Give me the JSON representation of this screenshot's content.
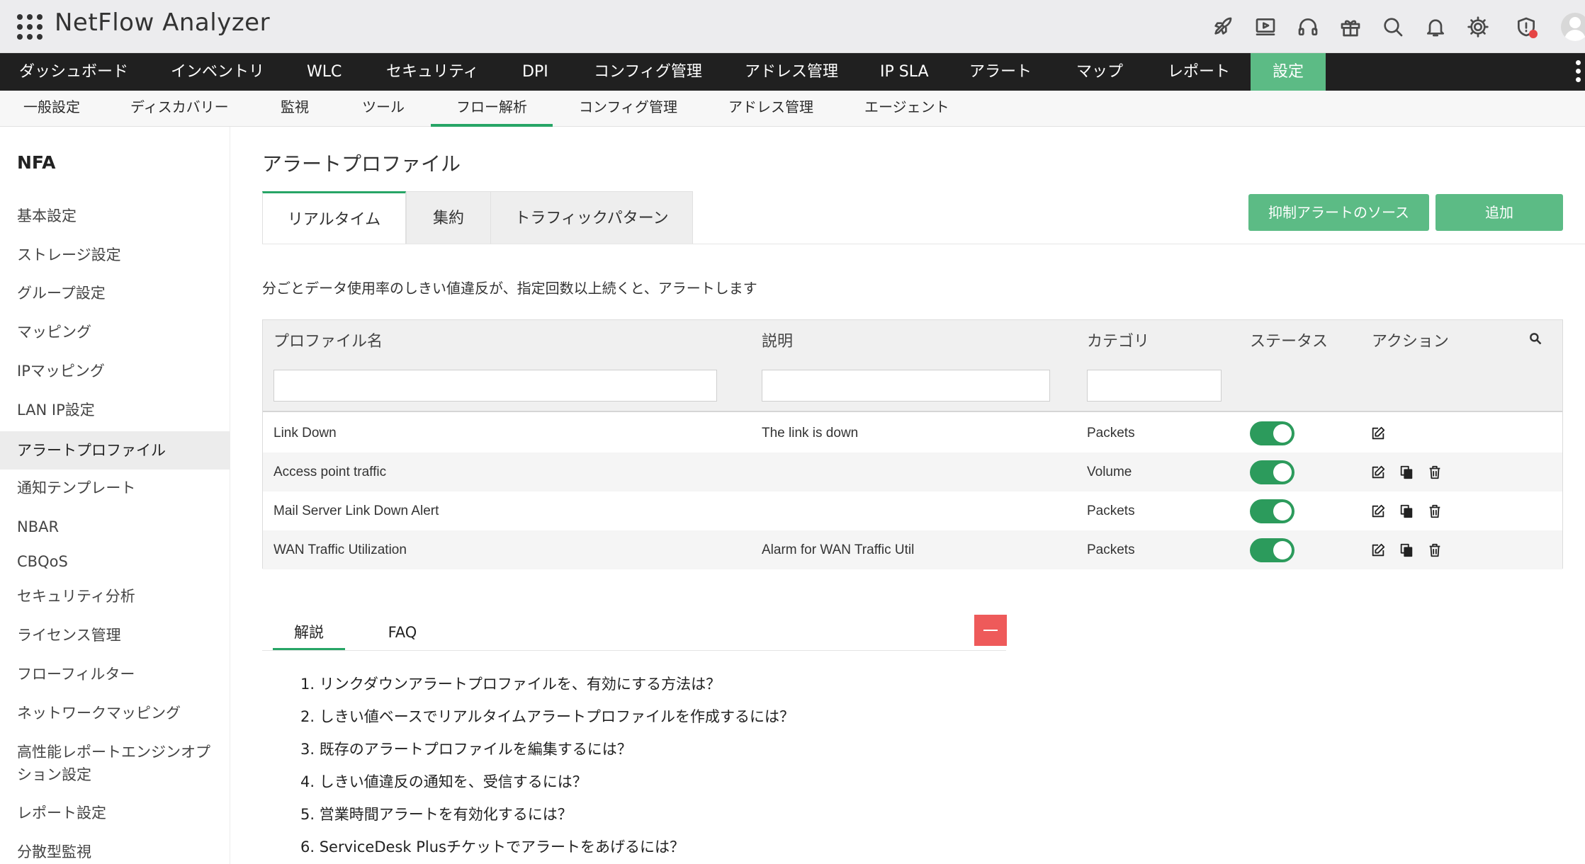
{
  "app": {
    "title": "NetFlow Analyzer"
  },
  "topbar_icons": [
    "rocket-icon",
    "video-icon",
    "headset-icon",
    "gift-icon",
    "search-icon",
    "bell-icon",
    "gear-icon",
    "alert-shield-icon",
    "avatar"
  ],
  "main_nav": [
    {
      "label": "ダッシュボード"
    },
    {
      "label": "インベントリ"
    },
    {
      "label": "WLC"
    },
    {
      "label": "セキュリティ"
    },
    {
      "label": "DPI"
    },
    {
      "label": "コンフィグ管理"
    },
    {
      "label": "アドレス管理"
    },
    {
      "label": "IP SLA"
    },
    {
      "label": "アラート"
    },
    {
      "label": "マップ"
    },
    {
      "label": "レポート"
    },
    {
      "label": "設定",
      "active": true
    }
  ],
  "sub_nav": [
    {
      "label": "一般設定"
    },
    {
      "label": "ディスカバリー"
    },
    {
      "label": "監視"
    },
    {
      "label": "ツール"
    },
    {
      "label": "フロー解析",
      "active": true
    },
    {
      "label": "コンフィグ管理"
    },
    {
      "label": "アドレス管理"
    },
    {
      "label": "エージェント"
    }
  ],
  "sidebar": {
    "title": "NFA",
    "items": [
      {
        "label": "基本設定"
      },
      {
        "label": "ストレージ設定"
      },
      {
        "label": "グループ設定"
      },
      {
        "label": "マッピング"
      },
      {
        "label": "IPマッピング"
      },
      {
        "label": "LAN IP設定"
      },
      {
        "label": "アラートプロファイル",
        "active": true
      },
      {
        "label": "通知テンプレート"
      },
      {
        "label": "NBAR"
      },
      {
        "label": "CBQoS"
      },
      {
        "label": "セキュリティ分析"
      },
      {
        "label": "ライセンス管理"
      },
      {
        "label": "フローフィルター"
      },
      {
        "label": "ネットワークマッピング"
      },
      {
        "label": "高性能レポートエンジンオプション設定"
      },
      {
        "label": "レポート設定"
      },
      {
        "label": "分散型監視"
      }
    ]
  },
  "page": {
    "title": "アラートプロファイル",
    "tabs": [
      {
        "label": "リアルタイム",
        "active": true
      },
      {
        "label": "集約"
      },
      {
        "label": "トラフィックパターン"
      }
    ],
    "buttons": {
      "suppress": "抑制アラートのソース",
      "add": "追加"
    },
    "description": "分ごとデータ使用率のしきい値違反が、指定回数以上続くと、アラートします"
  },
  "table": {
    "headers": {
      "name": "プロファイル名",
      "description": "説明",
      "category": "カテゴリ",
      "status": "ステータス",
      "action": "アクション"
    },
    "filters": {
      "name": "",
      "description": "",
      "category": ""
    },
    "rows": [
      {
        "name": "Link Down",
        "description": "The link is down",
        "category": "Packets",
        "status": "on",
        "actions": [
          "edit-icon"
        ]
      },
      {
        "name": "Access point traffic",
        "description": "",
        "category": "Volume",
        "status": "on",
        "actions": [
          "edit-icon",
          "copy-icon",
          "delete-icon"
        ]
      },
      {
        "name": "Mail Server Link Down Alert",
        "description": "",
        "category": "Packets",
        "status": "on",
        "actions": [
          "edit-icon",
          "copy-icon",
          "delete-icon"
        ]
      },
      {
        "name": "WAN Traffic Utilization",
        "description": "Alarm for WAN Traffic Util",
        "category": "Packets",
        "status": "on",
        "actions": [
          "edit-icon",
          "copy-icon",
          "delete-icon"
        ]
      }
    ]
  },
  "help": {
    "tabs": [
      {
        "label": "解説",
        "active": true
      },
      {
        "label": "FAQ"
      }
    ],
    "items": [
      "1. リンクダウンアラートプロファイルを、有効にする方法は？",
      "2. しきい値ベースでリアルタイムアラートプロファイルを作成するには？",
      "3. 既存のアラートプロファイルを編集するには？",
      "4. しきい値違反の通知を、受信するには？",
      "5. 営業時間アラートを有効化するには？",
      "6. ServiceDesk Plusチケットでアラートをあげるには？"
    ]
  },
  "colors": {
    "accent": "#5cbb85",
    "accent_dark": "#27a566",
    "toggle_on": "#2c9b5c",
    "nav_bg": "#202020",
    "collapse": "#ee5a5a"
  }
}
